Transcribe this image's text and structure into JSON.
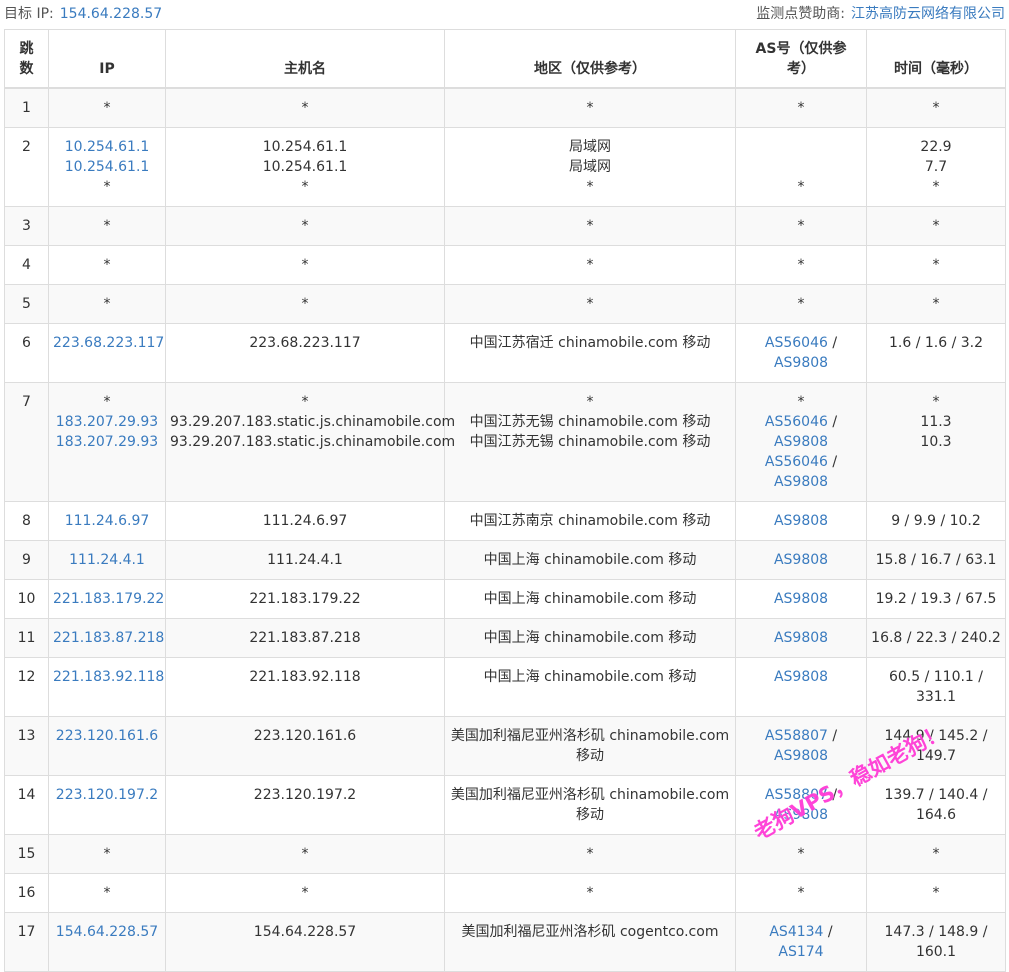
{
  "header": {
    "target_label": "目标 IP:",
    "target_ip": "154.64.228.57",
    "sponsor_label": "监测点赞助商:",
    "sponsor_name": "江苏高防云网络有限公司"
  },
  "columns": {
    "hop": "跳数",
    "ip": "IP",
    "hostname": "主机名",
    "region": "地区（仅供参考）",
    "as": "AS号（仅供参考）",
    "time": "时间（毫秒）"
  },
  "rows": [
    {
      "hop": "1",
      "ips": [
        "*"
      ],
      "hosts": [
        "*"
      ],
      "regions": [
        "*"
      ],
      "as": [
        [
          "*"
        ]
      ],
      "times": [
        "*"
      ]
    },
    {
      "hop": "2",
      "ips": [
        "10.254.61.1",
        "10.254.61.1",
        "*"
      ],
      "hosts": [
        "10.254.61.1",
        "10.254.61.1",
        "*"
      ],
      "regions": [
        "局域网",
        "局域网",
        "*"
      ],
      "as": [
        [
          ""
        ],
        [
          ""
        ],
        [
          "*"
        ]
      ],
      "times": [
        "22.9",
        "7.7",
        "*"
      ]
    },
    {
      "hop": "3",
      "ips": [
        "*"
      ],
      "hosts": [
        "*"
      ],
      "regions": [
        "*"
      ],
      "as": [
        [
          "*"
        ]
      ],
      "times": [
        "*"
      ]
    },
    {
      "hop": "4",
      "ips": [
        "*"
      ],
      "hosts": [
        "*"
      ],
      "regions": [
        "*"
      ],
      "as": [
        [
          "*"
        ]
      ],
      "times": [
        "*"
      ]
    },
    {
      "hop": "5",
      "ips": [
        "*"
      ],
      "hosts": [
        "*"
      ],
      "regions": [
        "*"
      ],
      "as": [
        [
          "*"
        ]
      ],
      "times": [
        "*"
      ]
    },
    {
      "hop": "6",
      "ips": [
        "223.68.223.117"
      ],
      "hosts": [
        "223.68.223.117"
      ],
      "regions": [
        "中国江苏宿迁 chinamobile.com 移动"
      ],
      "as": [
        [
          "AS56046",
          "AS9808"
        ]
      ],
      "times": [
        "1.6 / 1.6 / 3.2"
      ]
    },
    {
      "hop": "7",
      "ips": [
        "*",
        "183.207.29.93",
        "183.207.29.93"
      ],
      "hosts": [
        "*",
        "93.29.207.183.static.js.chinamobile.com",
        "93.29.207.183.static.js.chinamobile.com"
      ],
      "regions": [
        "*",
        "中国江苏无锡 chinamobile.com 移动",
        "中国江苏无锡 chinamobile.com 移动"
      ],
      "as": [
        [
          "*"
        ],
        [
          "AS56046",
          "AS9808"
        ],
        [
          "AS56046",
          "AS9808"
        ]
      ],
      "times": [
        "*",
        "11.3",
        "10.3"
      ]
    },
    {
      "hop": "8",
      "ips": [
        "111.24.6.97"
      ],
      "hosts": [
        "111.24.6.97"
      ],
      "regions": [
        "中国江苏南京 chinamobile.com 移动"
      ],
      "as": [
        [
          "AS9808"
        ]
      ],
      "times": [
        "9 / 9.9 / 10.2"
      ]
    },
    {
      "hop": "9",
      "ips": [
        "111.24.4.1"
      ],
      "hosts": [
        "111.24.4.1"
      ],
      "regions": [
        "中国上海 chinamobile.com 移动"
      ],
      "as": [
        [
          "AS9808"
        ]
      ],
      "times": [
        "15.8 / 16.7 / 63.1"
      ]
    },
    {
      "hop": "10",
      "ips": [
        "221.183.179.22"
      ],
      "hosts": [
        "221.183.179.22"
      ],
      "regions": [
        "中国上海 chinamobile.com 移动"
      ],
      "as": [
        [
          "AS9808"
        ]
      ],
      "times": [
        "19.2 / 19.3 / 67.5"
      ]
    },
    {
      "hop": "11",
      "ips": [
        "221.183.87.218"
      ],
      "hosts": [
        "221.183.87.218"
      ],
      "regions": [
        "中国上海 chinamobile.com 移动"
      ],
      "as": [
        [
          "AS9808"
        ]
      ],
      "times": [
        "16.8 / 22.3 / 240.2"
      ]
    },
    {
      "hop": "12",
      "ips": [
        "221.183.92.118"
      ],
      "hosts": [
        "221.183.92.118"
      ],
      "regions": [
        "中国上海 chinamobile.com 移动"
      ],
      "as": [
        [
          "AS9808"
        ]
      ],
      "times": [
        "60.5 / 110.1 / 331.1"
      ]
    },
    {
      "hop": "13",
      "ips": [
        "223.120.161.6"
      ],
      "hosts": [
        "223.120.161.6"
      ],
      "regions": [
        "美国加利福尼亚州洛杉矶 chinamobile.com 移动"
      ],
      "as": [
        [
          "AS58807",
          "AS9808"
        ]
      ],
      "times": [
        "144.9 / 145.2 / 149.7"
      ]
    },
    {
      "hop": "14",
      "ips": [
        "223.120.197.2"
      ],
      "hosts": [
        "223.120.197.2"
      ],
      "regions": [
        "美国加利福尼亚州洛杉矶 chinamobile.com 移动"
      ],
      "as": [
        [
          "AS58807",
          "AS9808"
        ]
      ],
      "times": [
        "139.7 / 140.4 / 164.6"
      ]
    },
    {
      "hop": "15",
      "ips": [
        "*"
      ],
      "hosts": [
        "*"
      ],
      "regions": [
        "*"
      ],
      "as": [
        [
          "*"
        ]
      ],
      "times": [
        "*"
      ]
    },
    {
      "hop": "16",
      "ips": [
        "*"
      ],
      "hosts": [
        "*"
      ],
      "regions": [
        "*"
      ],
      "as": [
        [
          "*"
        ]
      ],
      "times": [
        "*"
      ]
    },
    {
      "hop": "17",
      "ips": [
        "154.64.228.57"
      ],
      "hosts": [
        "154.64.228.57"
      ],
      "regions": [
        "美国加利福尼亚州洛杉矶 cogentco.com"
      ],
      "as": [
        [
          "AS4134",
          "AS174"
        ]
      ],
      "times": [
        "147.3 / 148.9 / 160.1"
      ]
    }
  ],
  "watermark": "老狗VPS，稳如老狗！",
  "colors": {
    "link": "#3a7bbf",
    "border": "#dddddd",
    "stripe": "#f9f9f9",
    "watermark": "#ff3bd6"
  }
}
